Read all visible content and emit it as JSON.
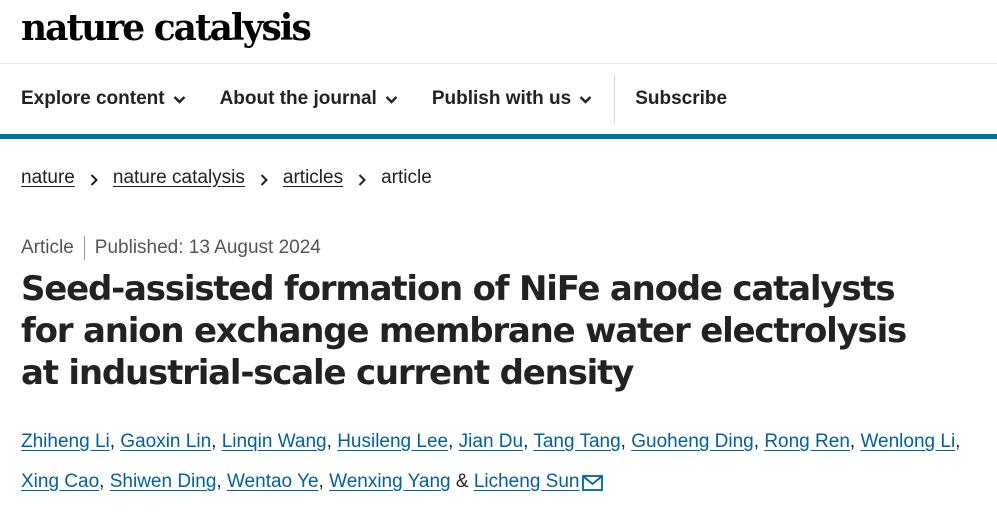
{
  "header": {
    "logo_text": "nature catalysis"
  },
  "nav": {
    "items": [
      {
        "label": "Explore content",
        "icon": "chevron-down-icon"
      },
      {
        "label": "About the journal",
        "icon": "chevron-down-icon"
      },
      {
        "label": "Publish with us",
        "icon": "chevron-down-icon"
      }
    ],
    "subscribe_label": "Subscribe",
    "accent_color": "#0070a8"
  },
  "breadcrumb": {
    "items": [
      "nature",
      "nature catalysis",
      "articles"
    ],
    "current": "article"
  },
  "article": {
    "type": "Article",
    "published": "Published: 13 August 2024",
    "title": "Seed-assisted formation of NiFe anode catalysts for anion exchange membrane water electrolysis at industrial-scale current density",
    "authors": [
      "Zhiheng Li",
      "Gaoxin Lin",
      "Linqin Wang",
      "Husileng Lee",
      "Jian Du",
      "Tang Tang",
      "Guoheng Ding",
      "Rong Ren",
      "Wenlong Li",
      "Xing Cao",
      "Shiwen Ding",
      "Wentao Ye",
      "Wenxing Yang",
      "Licheng Sun"
    ],
    "author_separator": ", ",
    "last_separator": " & ",
    "contact_icon": "mail-icon",
    "link_color": "#0060a0"
  }
}
